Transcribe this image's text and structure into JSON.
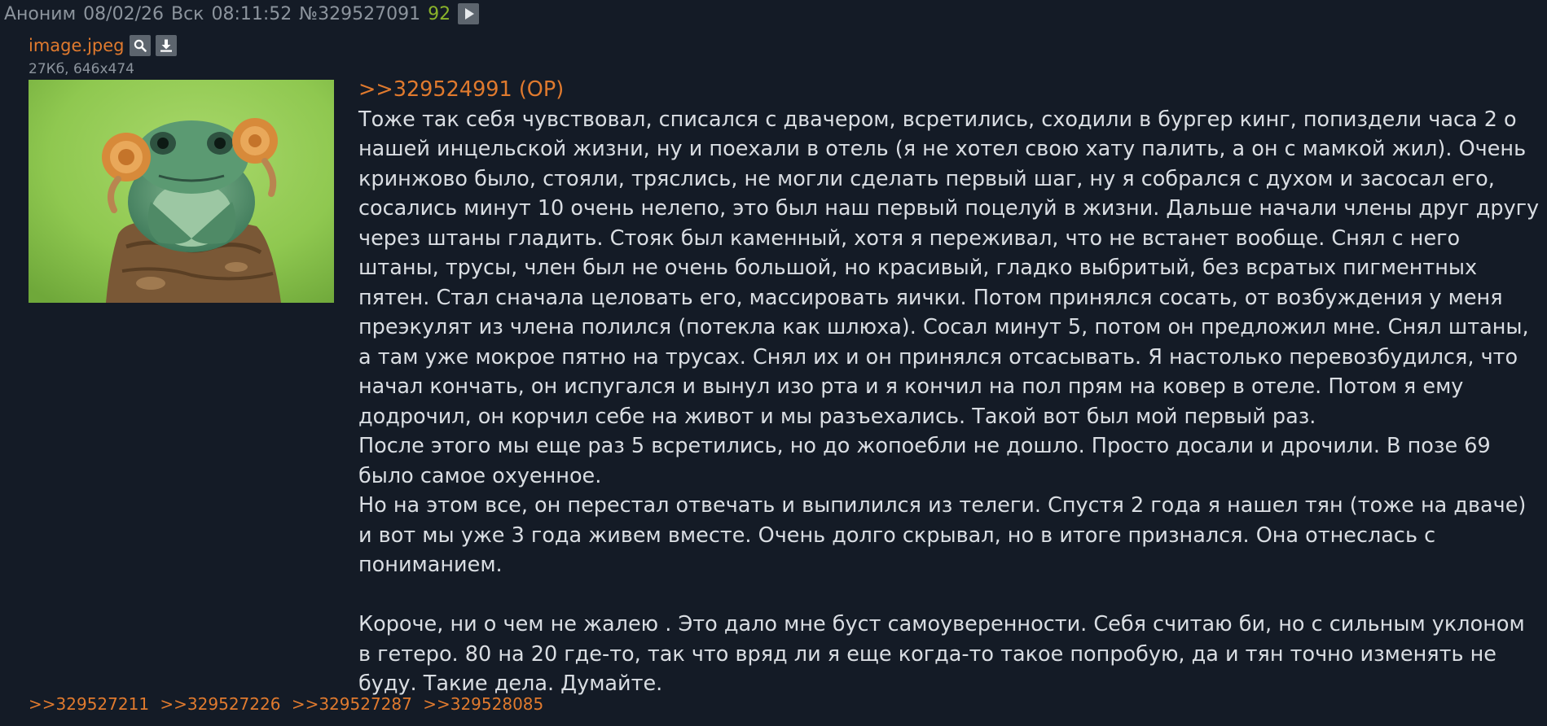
{
  "header": {
    "author": "Аноним",
    "date": "08/02/26",
    "day": "Вск",
    "time": "08:11:52",
    "post_number": "№329527091",
    "rating": "92"
  },
  "file": {
    "name": "image.jpeg",
    "meta": "27Кб, 646x474",
    "search_icon": "search-icon",
    "download_icon": "download-icon"
  },
  "body": {
    "quote_link": ">>329524991 (OP)",
    "paragraphs": [
      "Тоже так себя чувствовал, списался с двачером, всретились, сходили в бургер кинг, попиздели часа 2 о нашей инцельской жизни, ну и поехали в отель (я не хотел свою хату палить, а он с мамкой жил). Очень кринжово было, стояли, тряслись, не могли сделать первый шаг, ну я собрался с духом и засосал его, сосались минут 10 очень нелепо, это был наш первый поцелуй в жизни. Дальше начали члены друг другу через штаны гладить. Стояк был каменный, хотя я переживал, что не встанет вообще. Снял с него штаны, трусы, член был не очень большой, но красивый, гладко выбритый, без всратых пигментных пятен. Стал сначала целовать его, массировать яички. Потом принялся сосать, от возбуждения у меня преэкулят из члена полился (потекла как шлюха). Сосал минут 5, потом он предложил мне. Снял штаны, а там уже мокрое пятно на трусах. Снял их и он принялся отсасывать. Я настолько перевозбудился, что начал кончать, он испугался и вынул изо рта и я кончил на пол прям на ковер в отеле. Потом я ему додрочил, он корчил себе на живот и мы разъехались. Такой вот был мой первый раз.",
      "После этого мы еще раз 5 всретились, но до жопоебли не дошло. Просто досали и дрочили. В позе 69 было самое охуенное.",
      "Но на этом все, он перестал отвечать и выпилился из телеги. Спустя 2 года я нашел тян (тоже на дваче) и вот мы уже 3 года живем вместе. Очень долго скрывал, но в итоге признался. Она отнеслась с пониманием.",
      "Короче, ни о чем не жалею . Это дало мне буст самоуверенности. Себя считаю би, но с сильным уклоном в гетеро. 80 на 20 где-то, так что вряд ли я еще когда-то такое попробую, да и тян точно изменять не буду. Такие дела. Думайте."
    ]
  },
  "replies": [
    ">>329527211",
    ">>329527226",
    ">>329527287",
    ">>329528085"
  ],
  "colors": {
    "background": "#141b26",
    "link": "#e07a2e",
    "rating": "#8ab32a",
    "meta": "#8c949d",
    "text": "#d9dde2"
  }
}
